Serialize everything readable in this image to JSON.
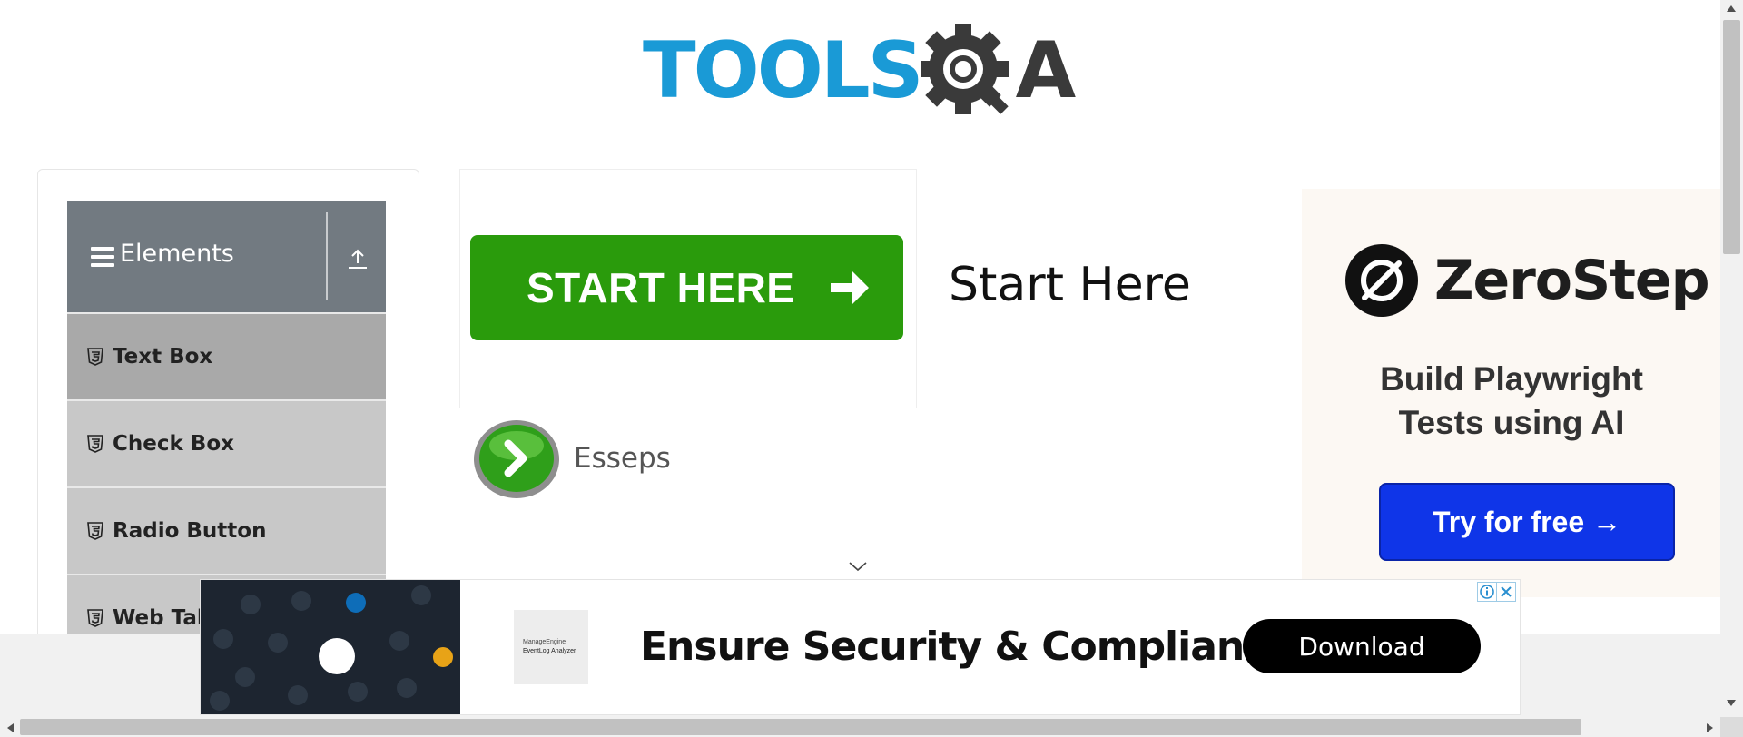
{
  "logo": {
    "tools": "TOOLS",
    "q": "Q",
    "a": "A"
  },
  "sidebar": {
    "group_title": "Elements",
    "items": [
      {
        "label": "Text Box",
        "active": true
      },
      {
        "label": "Check Box",
        "active": false
      },
      {
        "label": "Radio Button",
        "active": false
      },
      {
        "label": "Web Tab",
        "active": false
      }
    ]
  },
  "promo": {
    "button_label": "START HERE",
    "title": "Start Here",
    "brand": "Esseps"
  },
  "right_ad": {
    "brand": "ZeroStep",
    "tagline_line1": "Build Playwright",
    "tagline_line2": "Tests using AI",
    "cta": "Try for free →"
  },
  "bottom_ad": {
    "thumb_line1": "ManageEngine",
    "thumb_line2": "EventLog Analyzer",
    "headline": "Ensure Security & Compliance",
    "cta": "Download"
  },
  "colors": {
    "logo_blue": "#1a9ad6",
    "logo_dark": "#3a3a3a",
    "sidebar_header": "#727a81",
    "sidebar_active": "#a9a9a9",
    "sidebar_item": "#c8c8c8",
    "start_green": "#2a9b0c",
    "zerostep_blue": "#0f35e8"
  },
  "icons": {
    "menu": "hamburger-icon",
    "collapse": "upload-arrow-icon",
    "item": "html5-shield-icon",
    "start": "arrow-right-icon",
    "scroll_down": "chevron-down-icon",
    "ad_info": "info-icon",
    "ad_close": "close-icon"
  }
}
